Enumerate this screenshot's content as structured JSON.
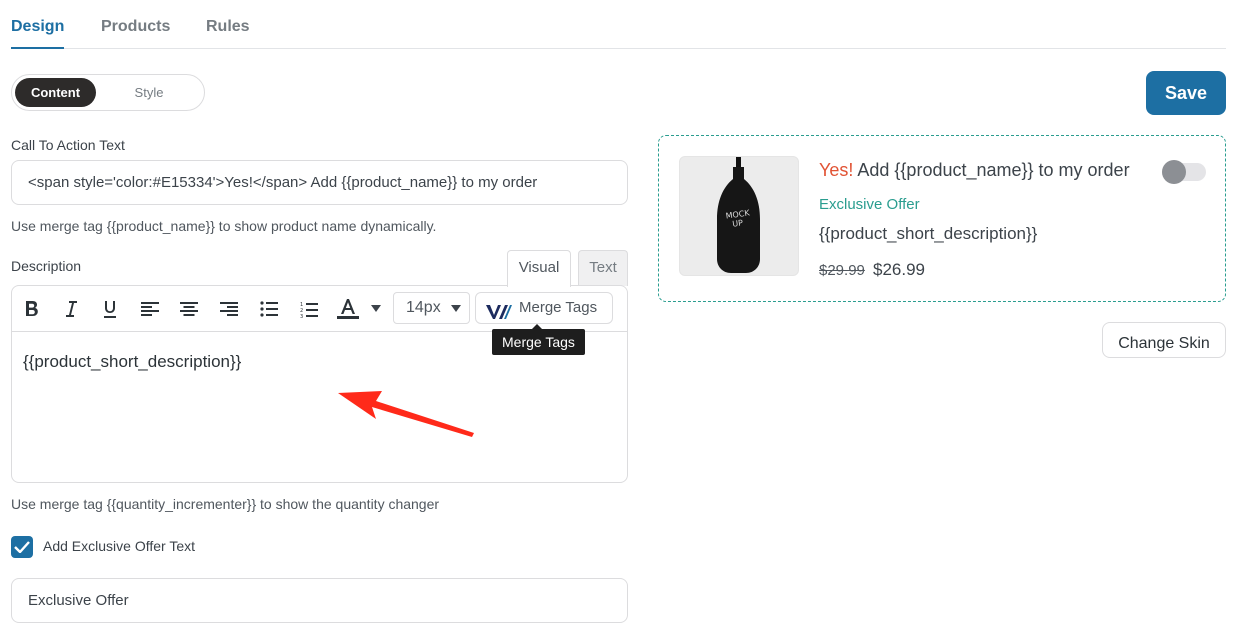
{
  "tabs": [
    "Design",
    "Products",
    "Rules"
  ],
  "content_tabs": [
    "Content",
    "Style"
  ],
  "save_label": "Save",
  "cta": {
    "label": "Call To Action Text",
    "value": "<span style='color:#E15334'>Yes!</span> Add {{product_name}} to my order",
    "hint": "Use merge tag {{product_name}} to show product name dynamically."
  },
  "description": {
    "label": "Description",
    "tabs": {
      "visual": "Visual",
      "text": "Text"
    },
    "font_size": "14px",
    "merge_tags_label": "Merge Tags",
    "tooltip": "Merge Tags",
    "content": "{{product_short_description}}",
    "hint": "Use merge tag {{quantity_incrementer}} to show the quantity changer"
  },
  "exclusive": {
    "checkbox_label": "Add Exclusive Offer Text",
    "checked": true,
    "value": "Exclusive Offer"
  },
  "preview": {
    "yes_text": "Yes!",
    "title_rest": " Add {{product_name}} to my order",
    "offer": "Exclusive Offer",
    "description": "{{product_short_description}}",
    "old_price": "$29.99",
    "new_price": "$26.99",
    "image_label_line1": "MOCK",
    "image_label_line2": "UP"
  },
  "change_skin_label": "Change Skin",
  "colors": {
    "accent": "#1d6fa3",
    "yes": "#E15334",
    "offer": "#2a9d8f",
    "arrow": "#ff2a1a"
  }
}
